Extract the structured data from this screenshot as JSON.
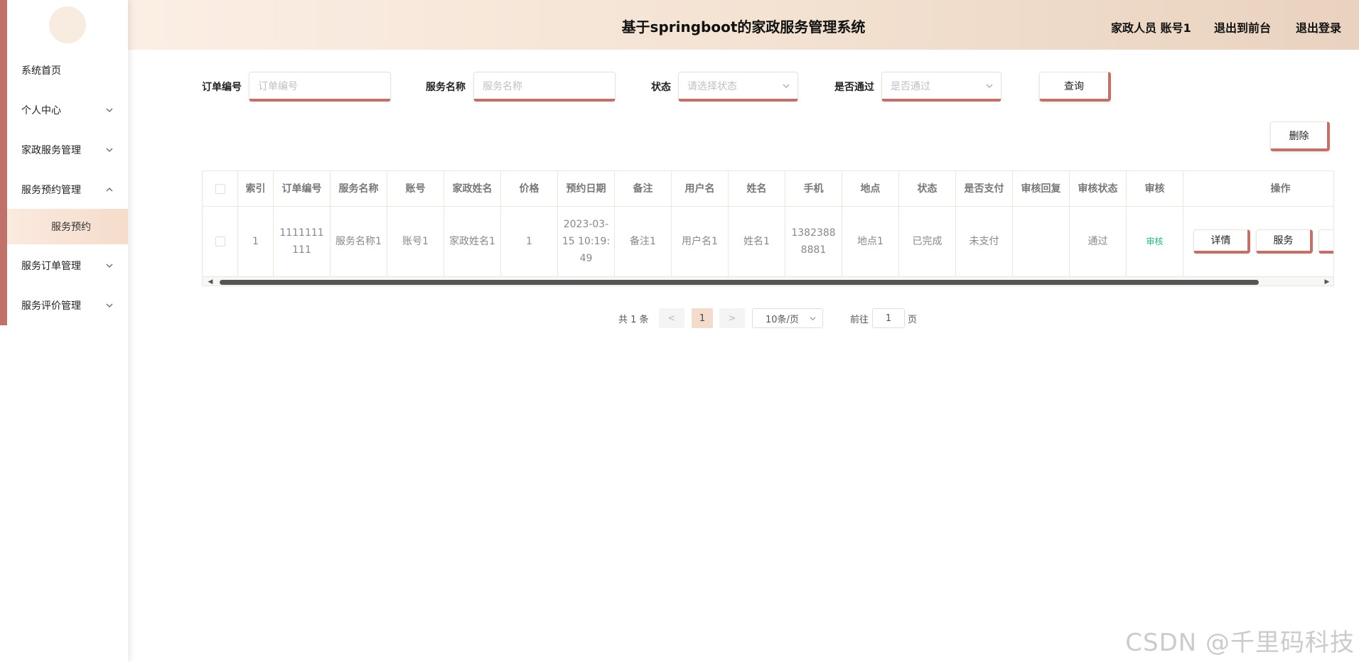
{
  "header": {
    "title": "基于springboot的家政服务管理系统",
    "user": "家政人员 账号1",
    "to_front": "退出到前台",
    "logout": "退出登录"
  },
  "sidebar": {
    "items": [
      {
        "label": "系统首页"
      },
      {
        "label": "个人中心"
      },
      {
        "label": "家政服务管理"
      },
      {
        "label": "服务预约管理"
      },
      {
        "label": "服务订单管理"
      },
      {
        "label": "服务评价管理"
      }
    ],
    "sub_item": "服务预约"
  },
  "search": {
    "order_label": "订单编号",
    "order_placeholder": "订单编号",
    "service_label": "服务名称",
    "service_placeholder": "服务名称",
    "status_label": "状态",
    "status_placeholder": "请选择状态",
    "pass_label": "是否通过",
    "pass_placeholder": "是否通过",
    "query_btn": "查询",
    "delete_btn": "删除"
  },
  "table": {
    "headers": [
      "索引",
      "订单编号",
      "服务名称",
      "账号",
      "家政姓名",
      "价格",
      "预约日期",
      "备注",
      "用户名",
      "姓名",
      "手机",
      "地点",
      "状态",
      "是否支付",
      "审核回复",
      "审核状态",
      "审核",
      "操作"
    ],
    "row": {
      "index": "1",
      "order_no": "1111111111",
      "service": "服务名称1",
      "account": "账号1",
      "staff": "家政姓名1",
      "price": "1",
      "date": "2023-03-15 10:19:49",
      "remark": "备注1",
      "username": "用户名1",
      "name": "姓名1",
      "phone": "13823888881",
      "place": "地点1",
      "status": "已完成",
      "paid": "未支付",
      "reply": "",
      "audit_status": "通过",
      "audit": "审核",
      "op_detail": "详情",
      "op_service": "服务"
    }
  },
  "pagination": {
    "total": "共 1 条",
    "prev": "<",
    "page": "1",
    "next": ">",
    "page_size": "10条/页",
    "goto_label": "前往",
    "goto_value": "1",
    "page_unit": "页"
  },
  "watermark": "CSDN @千里码科技",
  "colors": {
    "accent": "#c0716a",
    "header_bg": "#f4e3d3",
    "audit_link": "#23b37e"
  }
}
